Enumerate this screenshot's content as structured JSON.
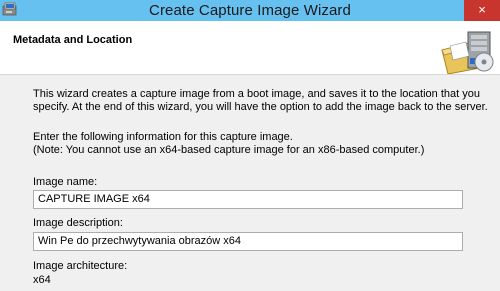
{
  "window": {
    "title": "Create Capture Image Wizard",
    "close_glyph": "×"
  },
  "header": {
    "heading": "Metadata and Location",
    "art_icon": "capture-wizard-icon"
  },
  "body": {
    "intro_line1": "This wizard creates a capture image from a boot image, and saves it to the location that you",
    "intro_line2": "specify. At the end of this wizard, you will have the option to add the image back to the server.",
    "instruction_line1": "Enter the following information for this capture image.",
    "instruction_line2": "(Note: You cannot use an x64-based capture image for an x86-based computer.)",
    "image_name_label": "Image name:",
    "image_name_value": "CAPTURE IMAGE x64",
    "image_description_label": "Image description:",
    "image_description_value": "Win Pe do przechwytywania obrazów x64",
    "architecture_label": "Image architecture:",
    "architecture_value": "x64"
  },
  "colors": {
    "titlebar": "#66c1f1",
    "close_button": "#c7352e",
    "body_background": "#f0f0f0"
  }
}
